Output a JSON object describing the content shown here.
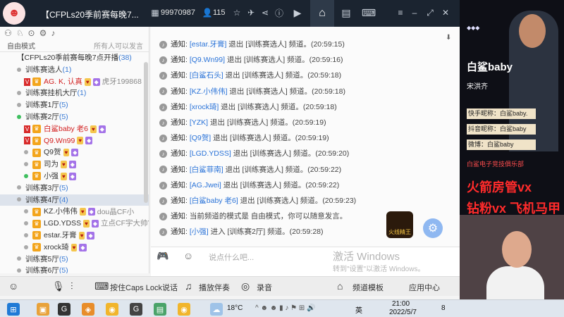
{
  "titlebar": {
    "channel_title": "【CFPLs20季前赛每晚7...",
    "room_id": "99970987",
    "online_count": "115"
  },
  "sidebar": {
    "mode_label": "自由模式",
    "permission_label": "所有人可以发言",
    "top_row": "【CFPLs20季前赛每晚7点开播",
    "top_count": "(38)",
    "rows": [
      {
        "type": "channel",
        "label": "训练赛选人",
        "count": "(1)"
      },
      {
        "type": "user",
        "name": "AG. K, 认真",
        "extra": "虎牙199868",
        "red": true
      },
      {
        "type": "channel",
        "label": "训练赛挂机大厅",
        "count": "(1)"
      },
      {
        "type": "channel",
        "label": "训练赛1厅",
        "count": "(5)"
      },
      {
        "type": "channel",
        "label": "训练赛2厅",
        "count": "(5)"
      },
      {
        "type": "user",
        "name": "白鲨baby 老6",
        "red": true
      },
      {
        "type": "user",
        "name": "Q9.Wn99",
        "red": true
      },
      {
        "type": "user",
        "name": "Q9贺"
      },
      {
        "type": "user",
        "name": "司为"
      },
      {
        "type": "user",
        "name": "小强"
      },
      {
        "type": "channel",
        "label": "训练赛3厅",
        "count": "(5)"
      },
      {
        "type": "channel",
        "label": "训练赛4厅",
        "count": "(4)"
      },
      {
        "type": "user",
        "name": "KZ.小伟伟",
        "extra": "dou晶CF小"
      },
      {
        "type": "user",
        "name": "LGD.YDSS",
        "extra": "立点CF宇大帅YDS"
      },
      {
        "type": "user",
        "name": "estar.牙膏"
      },
      {
        "type": "user",
        "name": "xrock琦"
      },
      {
        "type": "channel",
        "label": "训练赛5厅",
        "count": "(5)"
      },
      {
        "type": "channel",
        "label": "训练赛6厅",
        "count": "(5)"
      }
    ]
  },
  "chat": {
    "notice_label": "通知:",
    "messages": [
      {
        "nick": "[estar.牙膏]",
        "text": " 退出 [训练赛选人] 频道。",
        "time": "(20:59:15)"
      },
      {
        "nick": "[Q9.Wn99]",
        "text": " 退出 [训练赛选人] 频道。",
        "time": "(20:59:16)"
      },
      {
        "nick": "[白鲨石头]",
        "text": " 退出 [训练赛选人] 频道。",
        "time": "(20:59:18)"
      },
      {
        "nick": "[KZ.小伟伟]",
        "text": " 退出 [训练赛选人] 频道。",
        "time": "(20:59:18)"
      },
      {
        "nick": "[xrock琦]",
        "text": " 退出 [训练赛选人] 频道。",
        "time": "(20:59:18)"
      },
      {
        "nick": "[YZK]",
        "text": " 退出 [训练赛选人] 频道。",
        "time": "(20:59:19)"
      },
      {
        "nick": "[Q9贺]",
        "text": " 退出 [训练赛选人] 频道。",
        "time": "(20:59:19)"
      },
      {
        "nick": "[LGD.YDSS]",
        "text": " 退出 [训练赛选人] 频道。",
        "time": "(20:59:20)"
      },
      {
        "nick": "[白鲨菲南]",
        "text": " 退出 [训练赛选人] 频道。",
        "time": "(20:59:22)"
      },
      {
        "nick": "[AG.Jwei]",
        "text": " 退出 [训练赛选人] 频道。",
        "time": "(20:59:22)"
      },
      {
        "nick": "[白鲨baby 老6]",
        "text": " 退出 [训练赛选人] 频道。",
        "time": "(20:59:23)"
      },
      {
        "nick": "",
        "text": "当前频道的模式是 自由模式，你可以随意发言。",
        "time": ""
      },
      {
        "nick": "[小强]",
        "text": " 进入 [训练赛2厅] 频道。",
        "time": "(20:59:28)"
      }
    ],
    "badge_text": "火线精王"
  },
  "input": {
    "placeholder": "说点什么吧...",
    "watermark_line1": "激活 Windows",
    "watermark_line2": "转到\"设置\"以激活 Windows。"
  },
  "bottombar": {
    "caps_label": "按住Caps Lock说话",
    "music_label": "播放伴奏",
    "record_label": "录音",
    "template_label": "频道模板",
    "app_center_label": "应用中心"
  },
  "video": {
    "streamer_name": "白鲨baby",
    "real_name": "宋洪齐",
    "kuaishou": "快手昵称：白鲨baby.",
    "douyin": "抖音昵称：白鲨baby",
    "weibo": "微博：白鲨baby",
    "club": "白鲨电子竞技俱乐部",
    "promo1": "火箭房管vx",
    "promo2": "钻粉vx 飞机马甲"
  },
  "taskbar": {
    "weather": "18°C",
    "lang": "英",
    "time": "21:00",
    "date": "2022/5/7",
    "notify_count": "8"
  }
}
